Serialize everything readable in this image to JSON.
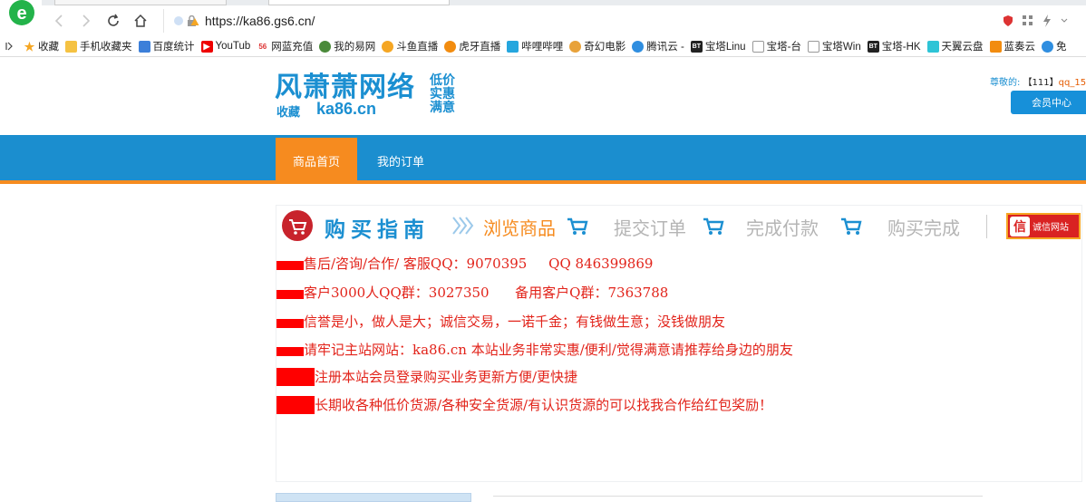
{
  "browser": {
    "url": "https://ka86.gs6.cn/",
    "bookmarks": [
      "收藏",
      "手机收藏夹",
      "百度统计",
      "YouTub",
      "网蓝充值",
      "我的易网",
      "斗鱼直播",
      "虎牙直播",
      "哔哩哔哩",
      "奇幻电影",
      "腾讯云 -",
      "宝塔Linu",
      "宝塔-台",
      "宝塔Win",
      "宝塔-HK",
      "天翼云盘",
      "蓝奏云",
      "免"
    ]
  },
  "header": {
    "logo_main": "风萧萧网络",
    "logo_sub_left": "收藏",
    "logo_sub_right": "ka86.cn",
    "slogan": [
      "低价",
      "实惠",
      "满意"
    ],
    "greeting_prefix": "尊敬的:",
    "greeting_id": "【111】",
    "greeting_user": "qq_15",
    "member_button": "会员中心"
  },
  "nav": {
    "home": "商品首页",
    "orders": "我的订单"
  },
  "guide": {
    "title": "购买指南",
    "steps": [
      "浏览商品",
      "提交订单",
      "完成付款",
      "购买完成"
    ],
    "credit_badge": "诚信网站",
    "credit_icon_char": "信"
  },
  "notices": [
    "售后/咨询/合作/ 客服QQ：9070395     QQ 846399869",
    "客户3000人QQ群：3027350      备用客户Q群：7363788",
    "信誉是小，做人是大；诚信交易，一诺千金；有钱做生意；没钱做朋友",
    "请牢记主站网站：ka86.cn 本站业务非常实惠/便利/觉得满意请推荐给身边的朋友",
    "注册本站会员登录购买业务更新方便/更快捷",
    "长期收各种低价货源/各种安全货源/有认识货源的可以找我合作给红包奖励！"
  ],
  "colors": {
    "brand_blue": "#1b8ecf",
    "accent_orange": "#f68b1f",
    "notice_red": "#e2231a"
  }
}
